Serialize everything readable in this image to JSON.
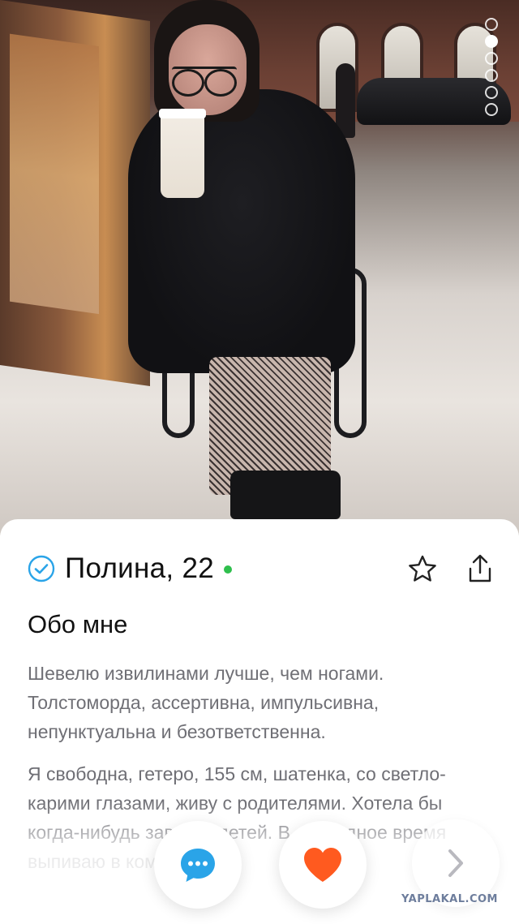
{
  "profile": {
    "name_age": "Полина, 22",
    "online": true,
    "verified": true
  },
  "about": {
    "title": "Обо мне",
    "paragraph_1": "Шевелю извилинами лучше, чем ногами. Толстоморда, ассертивна, импульсивна, непунктуальна и безответственна.",
    "paragraph_2": "Я свободна, гетеро, 155 см, шатенка, со светло-карими глазами, живу с родителями. Хотела бы когда-нибудь завести детей. В свободное время выпиваю в компании."
  },
  "story": {
    "total": 6,
    "active_index": 1
  },
  "actions": {
    "chat_icon": "chat-bubble-icon",
    "like_icon": "heart-icon",
    "next_icon": "chevron-right-icon",
    "favorite_icon": "star-icon",
    "share_icon": "share-icon"
  },
  "colors": {
    "accent_blue": "#2aa4e8",
    "like_orange": "#ff5a1f",
    "online_green": "#2fbf4d",
    "verified_blue": "#2aa4e8"
  },
  "watermark": "YAPLAKAL.COM"
}
